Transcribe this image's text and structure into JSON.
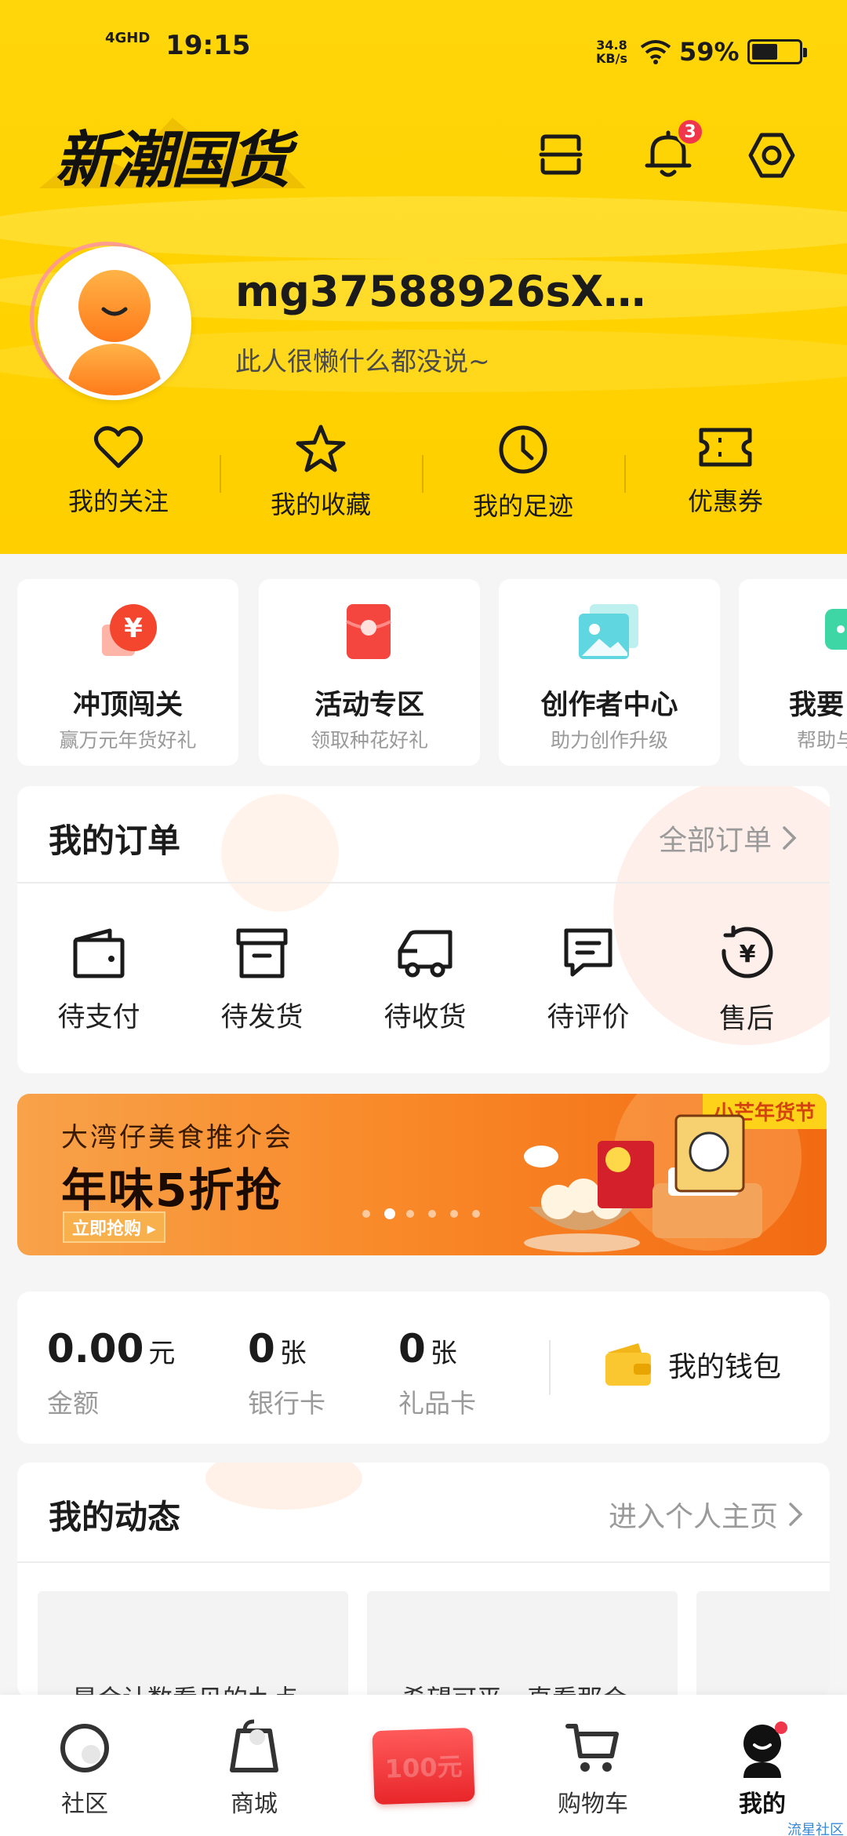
{
  "status_bar": {
    "network": "4GHD",
    "time": "19:15",
    "speed": "34.8",
    "speed_unit": "KB/s",
    "battery": "59%"
  },
  "header": {
    "logo_text": "新潮国货",
    "icons": [
      "scan-icon",
      "bell-icon",
      "settings-icon"
    ],
    "notification_count": "3",
    "username": "mg37588926sX…",
    "bio": "此人很懒什么都没说~",
    "quick_links": [
      {
        "label": "我的关注",
        "icon": "heart-icon"
      },
      {
        "label": "我的收藏",
        "icon": "star-icon"
      },
      {
        "label": "我的足迹",
        "icon": "clock-icon"
      },
      {
        "label": "优惠券",
        "icon": "coupon-icon"
      }
    ]
  },
  "features": [
    {
      "title": "冲顶闯关",
      "subtitle": "赢万元年货好礼",
      "icon": "red-envelope-yen-icon"
    },
    {
      "title": "活动专区",
      "subtitle": "领取种花好礼",
      "icon": "red-packet-icon"
    },
    {
      "title": "创作者中心",
      "subtitle": "助力创作升级",
      "icon": "image-gallery-icon"
    },
    {
      "title": "我要",
      "subtitle": "帮助与",
      "icon": "chat-icon"
    }
  ],
  "orders": {
    "title": "我的订单",
    "all_link": "全部订单",
    "items": [
      {
        "label": "待支付",
        "icon": "wallet-icon"
      },
      {
        "label": "待发货",
        "icon": "box-icon"
      },
      {
        "label": "待收货",
        "icon": "truck-icon"
      },
      {
        "label": "待评价",
        "icon": "comment-icon"
      },
      {
        "label": "售后",
        "icon": "refund-icon"
      }
    ]
  },
  "banner": {
    "subtitle": "大湾仔美食推介会",
    "headline": "年味5折抢",
    "cta": "立即抢购 ▸",
    "tag": "小芒年货节",
    "slide_count": 6,
    "active_slide": 2
  },
  "wallet": {
    "items": [
      {
        "value": "0.00",
        "unit": "元",
        "label": "金额"
      },
      {
        "value": "0",
        "unit": "张",
        "label": "银行卡"
      },
      {
        "value": "0",
        "unit": "张",
        "label": "礼品卡"
      }
    ],
    "wallet_label": "我的钱包"
  },
  "activity": {
    "title": "我的动态",
    "link": "进入个人主页",
    "posts": [
      "是会计数看见的九点",
      "希望可平一直看那会"
    ]
  },
  "bottom_nav": [
    {
      "label": "社区",
      "icon": "community-icon"
    },
    {
      "label": "商城",
      "icon": "shop-bag-icon"
    },
    {
      "label": "100元",
      "icon": "red-envelope-100-icon"
    },
    {
      "label": "购物车",
      "icon": "cart-icon"
    },
    {
      "label": "我的",
      "icon": "profile-icon"
    }
  ],
  "watermark": "流星社区",
  "colors": {
    "brand_yellow": "#ffd200",
    "badge_red": "#f0364a",
    "banner_orange": "#f77a1a",
    "text_dark": "#1b1b1b",
    "text_gray": "#9a9a9a"
  }
}
